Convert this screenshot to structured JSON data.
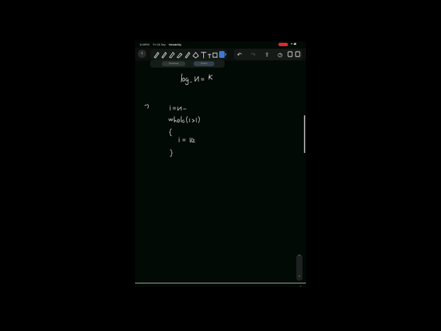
{
  "status_bar": {
    "time": "8:08PM",
    "date": "Fri 18 Sep",
    "app": "Notability",
    "icons": "⌖ ▰"
  },
  "toolbar": {
    "back_icon": "‹",
    "more_icon": "›",
    "undo_icon": "↶",
    "redo_icon": "↷",
    "share_icon": "⇪",
    "history_icon": "◷"
  },
  "subbar": {
    "shadows_label": "Shadows",
    "board_label": "Board"
  },
  "zoom": {
    "up_icon": "⌃",
    "down_icon": "⌄"
  },
  "corner_icon": "◞",
  "accent_color": "#3d78d6",
  "record_color": "#e0282d"
}
